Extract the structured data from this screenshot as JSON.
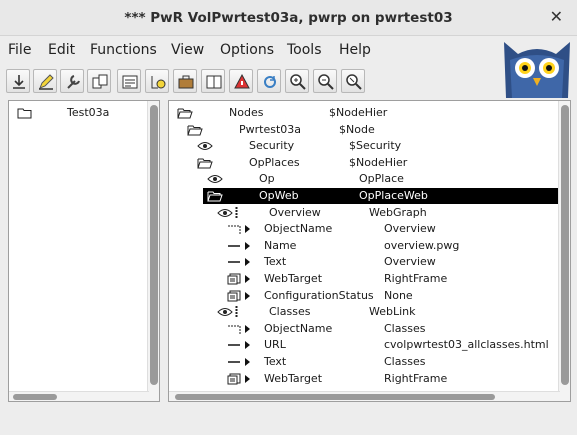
{
  "window": {
    "title": "*** PwR VolPwrtest03a,  pwrp on pwrtest03",
    "close_glyph": "✕"
  },
  "menu": [
    "File",
    "Edit",
    "Functions",
    "View",
    "Options",
    "Tools",
    "Help"
  ],
  "toolbar": [
    "save-icon",
    "edit-icon",
    "wrench-icon",
    "copy-icon",
    "attribute-icon",
    "open-graph-icon",
    "briefcase-icon",
    "book-icon",
    "alarm-icon",
    "refresh-icon",
    "zoom-in-icon",
    "zoom-out-icon",
    "zoom-reset-icon"
  ],
  "left_tree": [
    {
      "label": "Test03a",
      "icon": "folder-icon"
    }
  ],
  "right_tree": [
    {
      "name": "Nodes",
      "cls": "$NodeHier",
      "icon": "folder-open-icon",
      "arrow": false,
      "selected": false
    },
    {
      "name": "Pwrtest03a",
      "cls": "$Node",
      "icon": "folder-open-icon",
      "arrow": false,
      "selected": false
    },
    {
      "name": "Security",
      "cls": "$Security",
      "icon": "eye-icon",
      "arrow": false,
      "selected": false
    },
    {
      "name": "OpPlaces",
      "cls": "$NodeHier",
      "icon": "folder-open-icon",
      "arrow": false,
      "selected": false
    },
    {
      "name": "Op",
      "cls": "OpPlace",
      "icon": "eye-icon",
      "arrow": false,
      "selected": false
    },
    {
      "name": "OpWeb",
      "cls": "OpPlaceWeb",
      "icon": "folder-open-icon",
      "arrow": false,
      "selected": true
    },
    {
      "name": "Overview",
      "cls": "WebGraph",
      "icon": "eye-icon",
      "arrow": false,
      "selected": false
    },
    {
      "name": "ObjectName",
      "cls": "Overview",
      "icon": "attr-box-icon",
      "arrow": true,
      "selected": false
    },
    {
      "name": "Name",
      "cls": "overview.pwg",
      "icon": "attr-dash-icon",
      "arrow": true,
      "selected": false
    },
    {
      "name": "Text",
      "cls": "Overview",
      "icon": "attr-dash-icon",
      "arrow": true,
      "selected": false
    },
    {
      "name": "WebTarget",
      "cls": "RightFrame",
      "icon": "attr-enum-icon",
      "arrow": true,
      "selected": false
    },
    {
      "name": "ConfigurationStatus",
      "cls": "None",
      "icon": "attr-enum-icon",
      "arrow": true,
      "selected": false
    },
    {
      "name": "Classes",
      "cls": "WebLink",
      "icon": "eye-icon",
      "arrow": false,
      "selected": false
    },
    {
      "name": "ObjectName",
      "cls": "Classes",
      "icon": "attr-box-icon",
      "arrow": true,
      "selected": false
    },
    {
      "name": "URL",
      "cls": "cvolpwrtest03_allclasses.html",
      "icon": "attr-dash-icon",
      "arrow": true,
      "selected": false
    },
    {
      "name": "Text",
      "cls": "Classes",
      "icon": "attr-dash-icon",
      "arrow": true,
      "selected": false
    },
    {
      "name": "WebTarget",
      "cls": "RightFrame",
      "icon": "attr-enum-icon",
      "arrow": true,
      "selected": false
    }
  ],
  "colors": {
    "selection": "#000000",
    "owl_blue": "#2f4f86",
    "owl_eye": "#ffd21a"
  }
}
